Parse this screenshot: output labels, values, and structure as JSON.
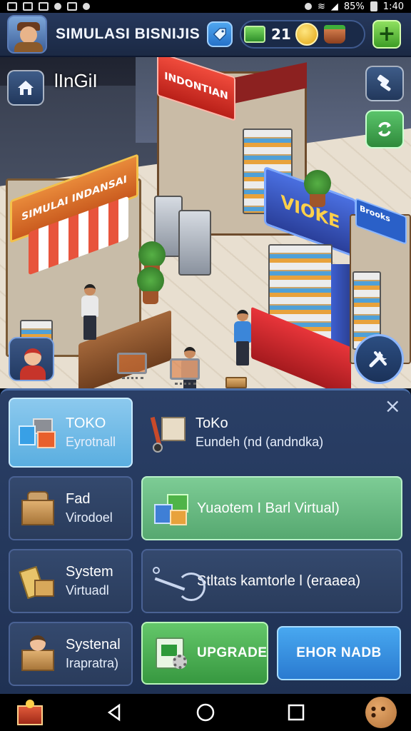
{
  "status_bar": {
    "battery": "85%",
    "time": "1:40"
  },
  "hud": {
    "title": "SIMULASI BISNIJIS",
    "currency_count": "21",
    "icons": [
      "avatar-icon",
      "tag-icon",
      "cash-icon",
      "coin-icon",
      "basket-icon",
      "plus-icon"
    ]
  },
  "scene": {
    "label": "lInGiI",
    "store_signs": {
      "left_store": "SIMULAI INDANSAI",
      "back_store": "INDONTIAN",
      "right_store": "VIOKE",
      "far_right_store": "Brooks"
    },
    "icons": [
      "home-icon",
      "hammer-icon",
      "refresh-icon",
      "wrench-icon",
      "assistant-icon"
    ]
  },
  "menu": {
    "tiles": [
      {
        "title": "TOKO",
        "subtitle": "Eyrotnall",
        "icon": "store-stack-icon"
      },
      {
        "title": "ToKo",
        "subtitle": "Eundeh (nd (andndka)",
        "icon": "hand-truck-icon"
      },
      {
        "title": "Fad",
        "subtitle": "Virodoel",
        "icon": "crate-icon"
      },
      {
        "label": "Yuaotem I Barl Virtual)",
        "icon": "gift-boxes-icon"
      },
      {
        "title": "System",
        "subtitle": "Virtuadl",
        "icon": "parcel-icon"
      },
      {
        "label": "Stltats kamtorle l (eraaea)",
        "icon": "scanner-icon"
      },
      {
        "title": "Systenal",
        "subtitle": "Irapratra)",
        "icon": "worker-box-icon"
      }
    ],
    "upgrade_label": "UPGRADE",
    "error_label": "EHOR NADB",
    "close_symbol": "×"
  },
  "colors": {
    "selected_tile": "#8cc9ee",
    "green_tile": "#7dcc95",
    "upgrade_button": "#64c76a",
    "error_button": "#48a8f0",
    "panel": "#2a3f66"
  }
}
